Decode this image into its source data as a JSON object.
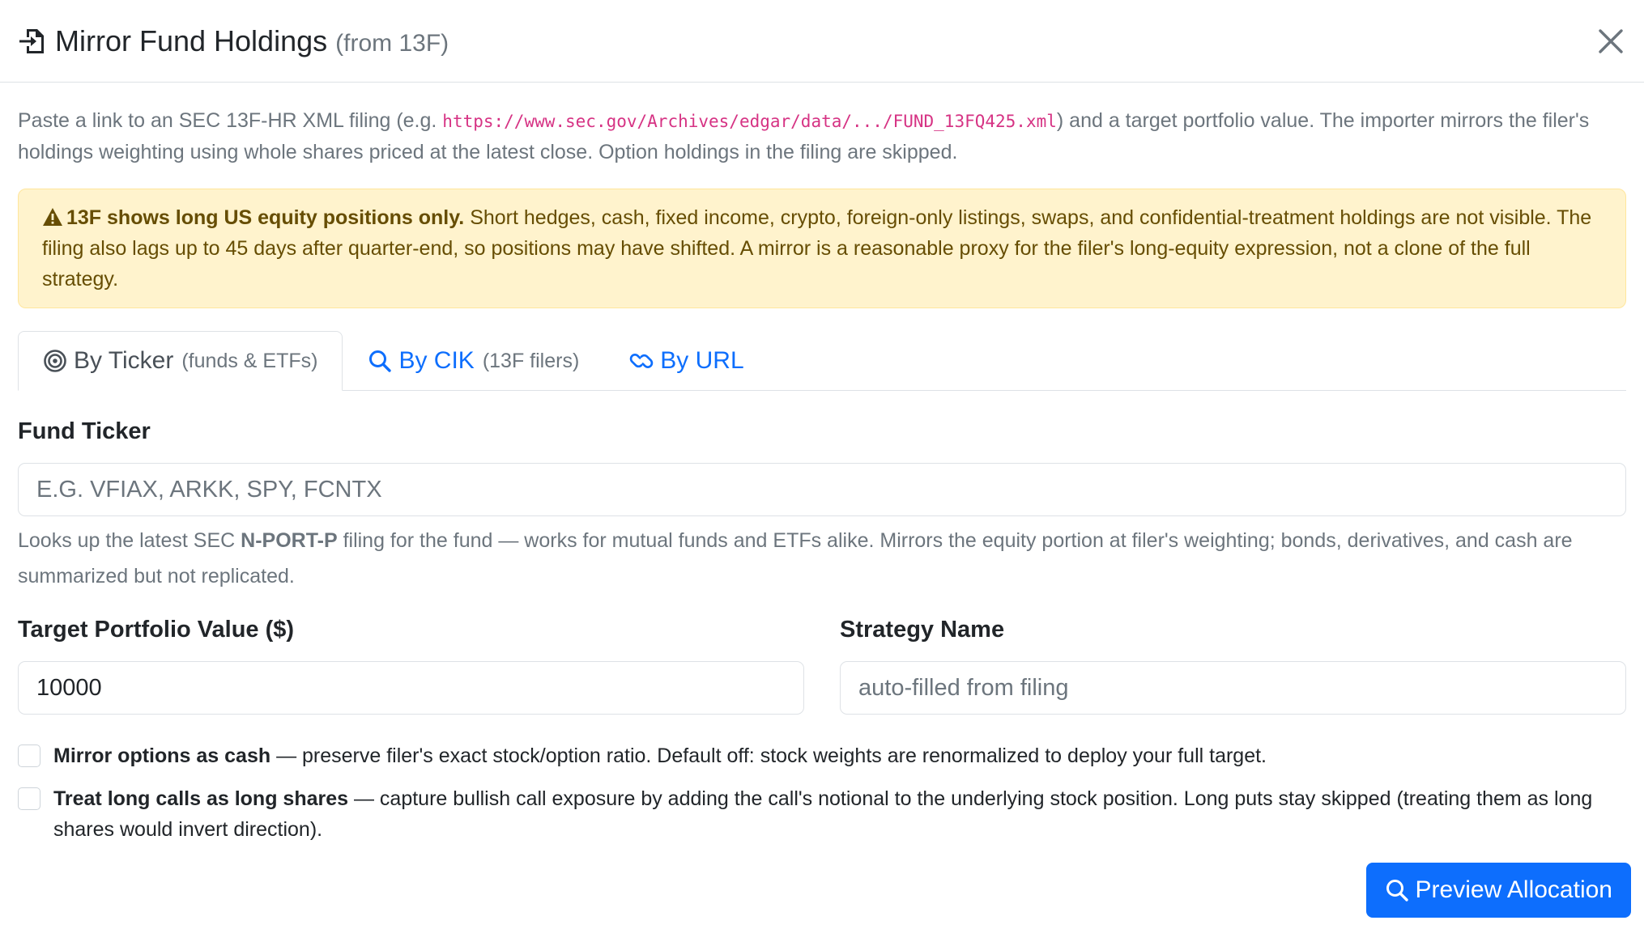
{
  "modal": {
    "title": "Mirror Fund Holdings",
    "title_sub": "(from 13F)"
  },
  "intro": {
    "before": "Paste a link to an SEC 13F-HR XML filing (e.g. ",
    "code": "https://www.sec.gov/Archives/edgar/data/.../FUND_13FQ425.xml",
    "after": ") and a target portfolio value. The importer mirrors the filer's holdings weighting using whole shares priced at the latest close. Option holdings in the filing are skipped."
  },
  "warning": {
    "bold": "13F shows long US equity positions only.",
    "text": " Short hedges, cash, fixed income, crypto, foreign-only listings, swaps, and confidential-treatment holdings are not visible. The filing also lags up to 45 days after quarter-end, so positions may have shifted. A mirror is a reasonable proxy for the filer's long-equity expression, not a clone of the full strategy."
  },
  "tabs": [
    {
      "label": "By Ticker",
      "sub": "(funds & ETFs)",
      "active": true
    },
    {
      "label": "By CIK",
      "sub": "(13F filers)",
      "active": false
    },
    {
      "label": "By URL",
      "sub": "",
      "active": false
    }
  ],
  "form": {
    "ticker_label": "Fund Ticker",
    "ticker_placeholder": "E.G. VFIAX, ARKK, SPY, FCNTX",
    "ticker_value": "",
    "help_before": "Looks up the latest SEC ",
    "help_bold": "N-PORT-P",
    "help_after": " filing for the fund — works for mutual funds and ETFs alike. Mirrors the equity portion at filer's weighting; bonds, derivatives, and cash are summarized but not replicated.",
    "target_label": "Target Portfolio Value ($)",
    "target_value": "10000",
    "strategy_label": "Strategy Name",
    "strategy_placeholder": "auto-filled from filing",
    "strategy_value": ""
  },
  "options": [
    {
      "bold": "Mirror options as cash",
      "text": " — preserve filer's exact stock/option ratio. Default off: stock weights are renormalized to deploy your full target.",
      "checked": false
    },
    {
      "bold": "Treat long calls as long shares",
      "text": " — capture bullish call exposure by adding the call's notional to the underlying stock position. Long puts stay skipped (treating them as long shares would invert direction).",
      "checked": false
    }
  ],
  "footer": {
    "preview_label": "Preview Allocation"
  },
  "colors": {
    "primary": "#0d6efd",
    "warning_bg": "#fff3cd",
    "warning_text": "#664d03",
    "muted": "#6c757d",
    "code": "#d63384"
  }
}
